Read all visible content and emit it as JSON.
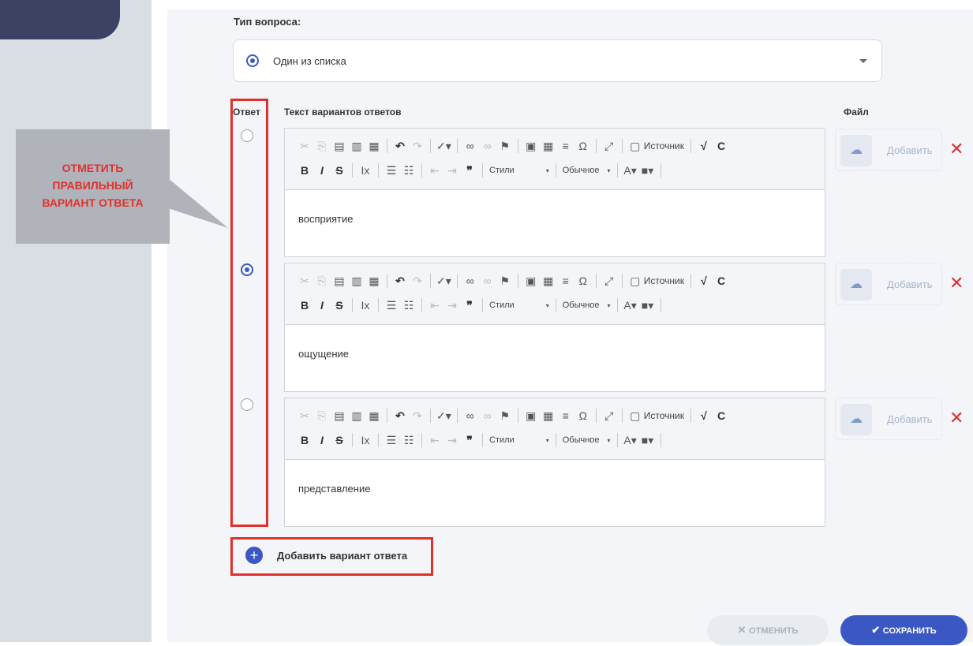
{
  "callout": {
    "lines": [
      "ОТМЕТИТЬ",
      "ПРАВИЛЬНЫЙ",
      "ВАРИАНТ ОТВЕТА"
    ]
  },
  "question_type": {
    "label": "Тип вопроса:",
    "selected": "Один из списка"
  },
  "columns": {
    "answer": "Ответ",
    "text": "Текст вариантов ответов",
    "file": "Файл"
  },
  "toolbar": {
    "source": "Источник",
    "styles": "Стили",
    "format": "Обычное",
    "bold": "B",
    "italic": "I",
    "strike": "S"
  },
  "answers": [
    {
      "text": "восприятие",
      "correct": false
    },
    {
      "text": "ощущение",
      "correct": true
    },
    {
      "text": "представление",
      "correct": false
    }
  ],
  "file": {
    "add_label": "Добавить"
  },
  "add_answer": {
    "label": "Добавить вариант ответа"
  },
  "buttons": {
    "cancel": "ОТМЕНИТЬ",
    "save": "СОХРАНИТЬ"
  },
  "colors": {
    "accent": "#3a57c4",
    "annotation_red": "#e1302b",
    "delete_red": "#d9332e",
    "sidebar": "#3b4262"
  },
  "icons": {
    "cut": "cut-icon",
    "copy": "copy-icon",
    "paste": "paste-icon",
    "undo": "undo-icon",
    "redo": "redo-icon",
    "spellcheck": "spellcheck-icon",
    "link": "link-icon",
    "unlink": "unlink-icon",
    "anchor": "flag-icon",
    "image": "image-icon",
    "table": "table-icon",
    "hr": "horizontal-line-icon",
    "special_char": "omega-icon",
    "maximize": "maximize-icon",
    "source": "source-icon",
    "math": "sqrt-icon",
    "chem": "c-icon",
    "upload": "cloud-upload-icon",
    "delete": "close-icon",
    "add": "plus-icon",
    "check": "check-icon"
  }
}
